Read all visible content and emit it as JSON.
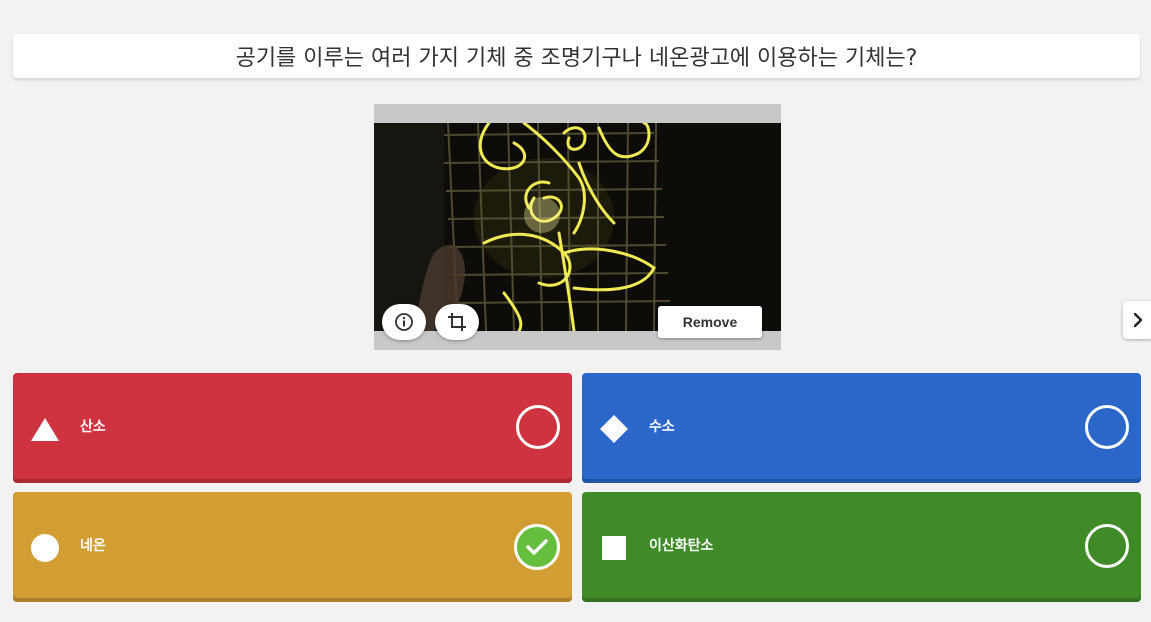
{
  "question": {
    "text": "공기를 이루는 여러 가지 기체 중 조명기구나 네온광고에 이용하는 기체는?"
  },
  "media": {
    "info_icon": "info-icon",
    "crop_icon": "crop-icon",
    "remove_label": "Remove"
  },
  "navigation": {
    "next_icon": "chevron-right-icon"
  },
  "answers": [
    {
      "label": "산소",
      "shape": "triangle",
      "color": "#d03340",
      "correct": false
    },
    {
      "label": "수소",
      "shape": "diamond",
      "color": "#2b66c9",
      "correct": false
    },
    {
      "label": "네온",
      "shape": "circle",
      "color": "#d29e33",
      "correct": true
    },
    {
      "label": "이산화탄소",
      "shape": "square",
      "color": "#3f8b28",
      "correct": false
    }
  ]
}
